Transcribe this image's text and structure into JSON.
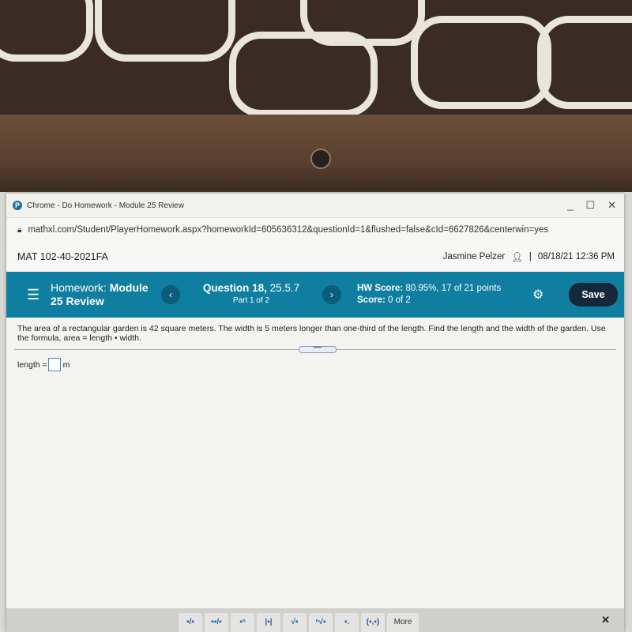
{
  "browser": {
    "window_title": "Chrome - Do Homework - Module 25 Review",
    "url": "mathxl.com/Student/PlayerHomework.aspx?homeworkId=605636312&questionId=1&flushed=false&cId=6627826&centerwin=yes",
    "controls": {
      "minimize": "_",
      "maximize": "☐",
      "close": "✕"
    }
  },
  "course": {
    "name": "MAT 102-40-2021FA",
    "user": "Jasmine Pelzer",
    "separator": "|",
    "datetime": "08/18/21 12:36 PM"
  },
  "homework": {
    "label": "Homework:",
    "title": "Module 25 Review",
    "question_label": "Question 18,",
    "question_id": "25.5.7",
    "part": "Part 1 of 2",
    "hw_score_label": "HW Score:",
    "hw_score_value": "80.95%, 17 of 21 points",
    "score_label": "Score:",
    "score_value": "0 of 2",
    "save_label": "Save",
    "prev": "‹",
    "next": "›"
  },
  "question": {
    "text": "The area of a rectangular garden is 42 square meters. The width is 5 meters longer than one-third of the length. Find the length and the width of the garden. Use the formula, area = length • width.",
    "answer_label": "length =",
    "answer_value": "",
    "unit": "m"
  },
  "palette": {
    "buttons": [
      "▪/▪",
      "▪▪/▪",
      "▪ⁿ",
      "|▪|",
      "√▪",
      "ⁿ√▪",
      "▪.",
      "(▪,▪)"
    ],
    "more_label": "More",
    "close": "✕"
  },
  "colors": {
    "accent": "#0f7ea0",
    "save_button": "#13283a"
  }
}
